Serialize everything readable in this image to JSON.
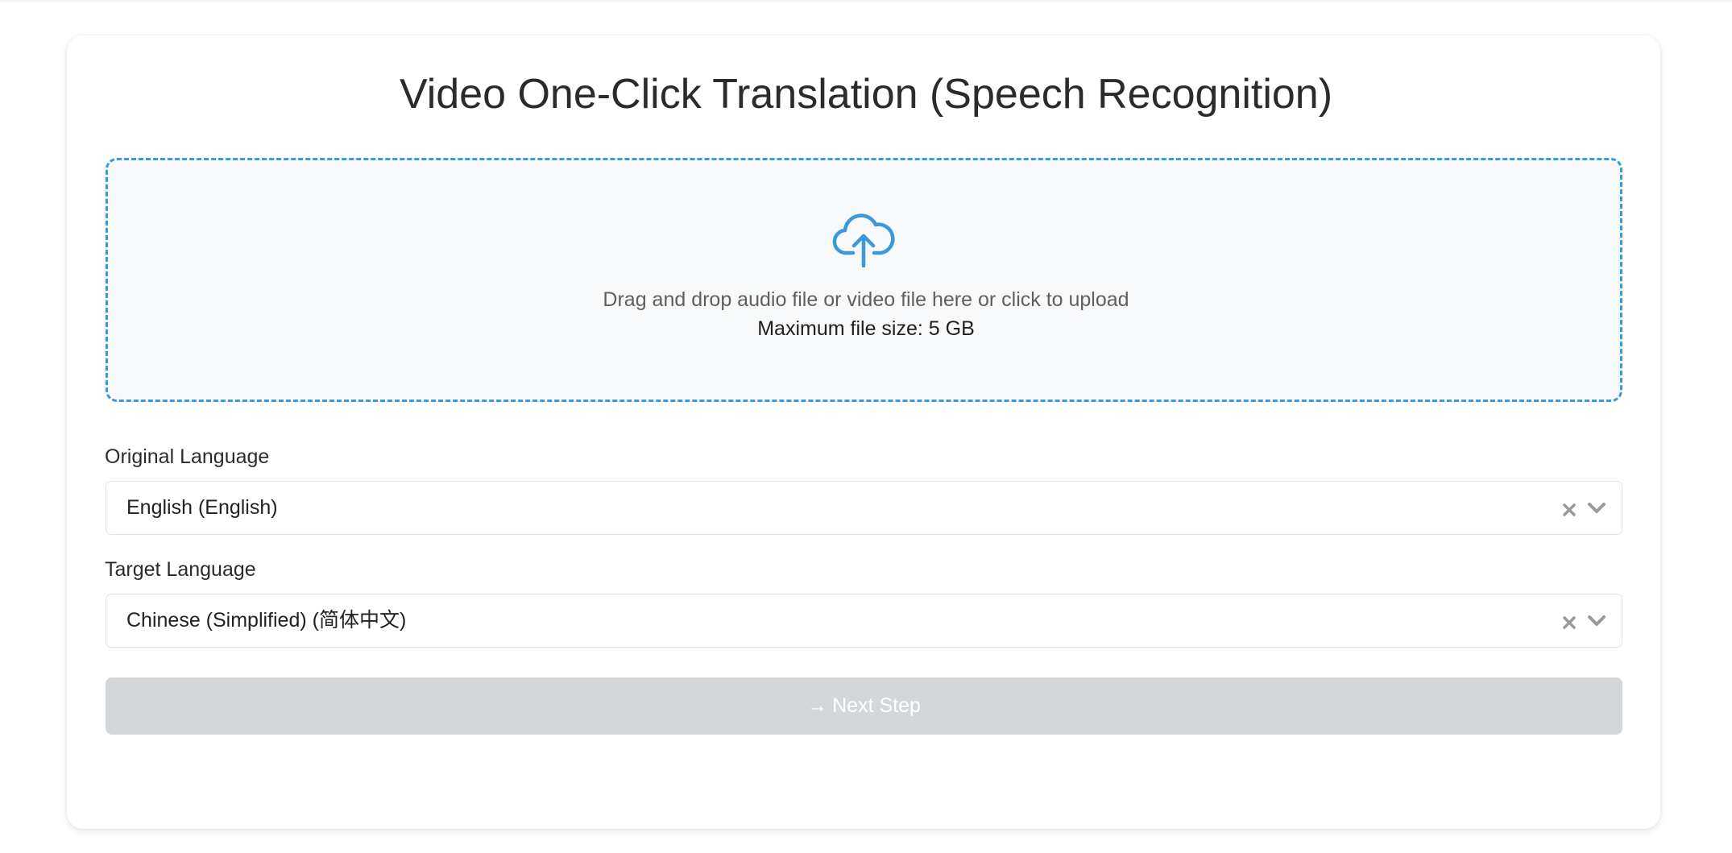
{
  "page": {
    "title": "Video One-Click Translation (Speech Recognition)"
  },
  "upload": {
    "icon": "cloud-upload-icon",
    "instruction": "Drag and drop audio file or video file here or click to upload",
    "max_size_text": "Maximum file size: 5 GB"
  },
  "original_language": {
    "label": "Original Language",
    "value": "English (English)"
  },
  "target_language": {
    "label": "Target Language",
    "value": "Chinese (Simplified) (简体中文)"
  },
  "next_button": {
    "arrow": "→",
    "label": "Next Step",
    "disabled": true
  },
  "colors": {
    "accent": "#3a9ad9",
    "dropzone_bg": "#f7f9fa",
    "button_disabled_bg": "#d4d7da"
  }
}
